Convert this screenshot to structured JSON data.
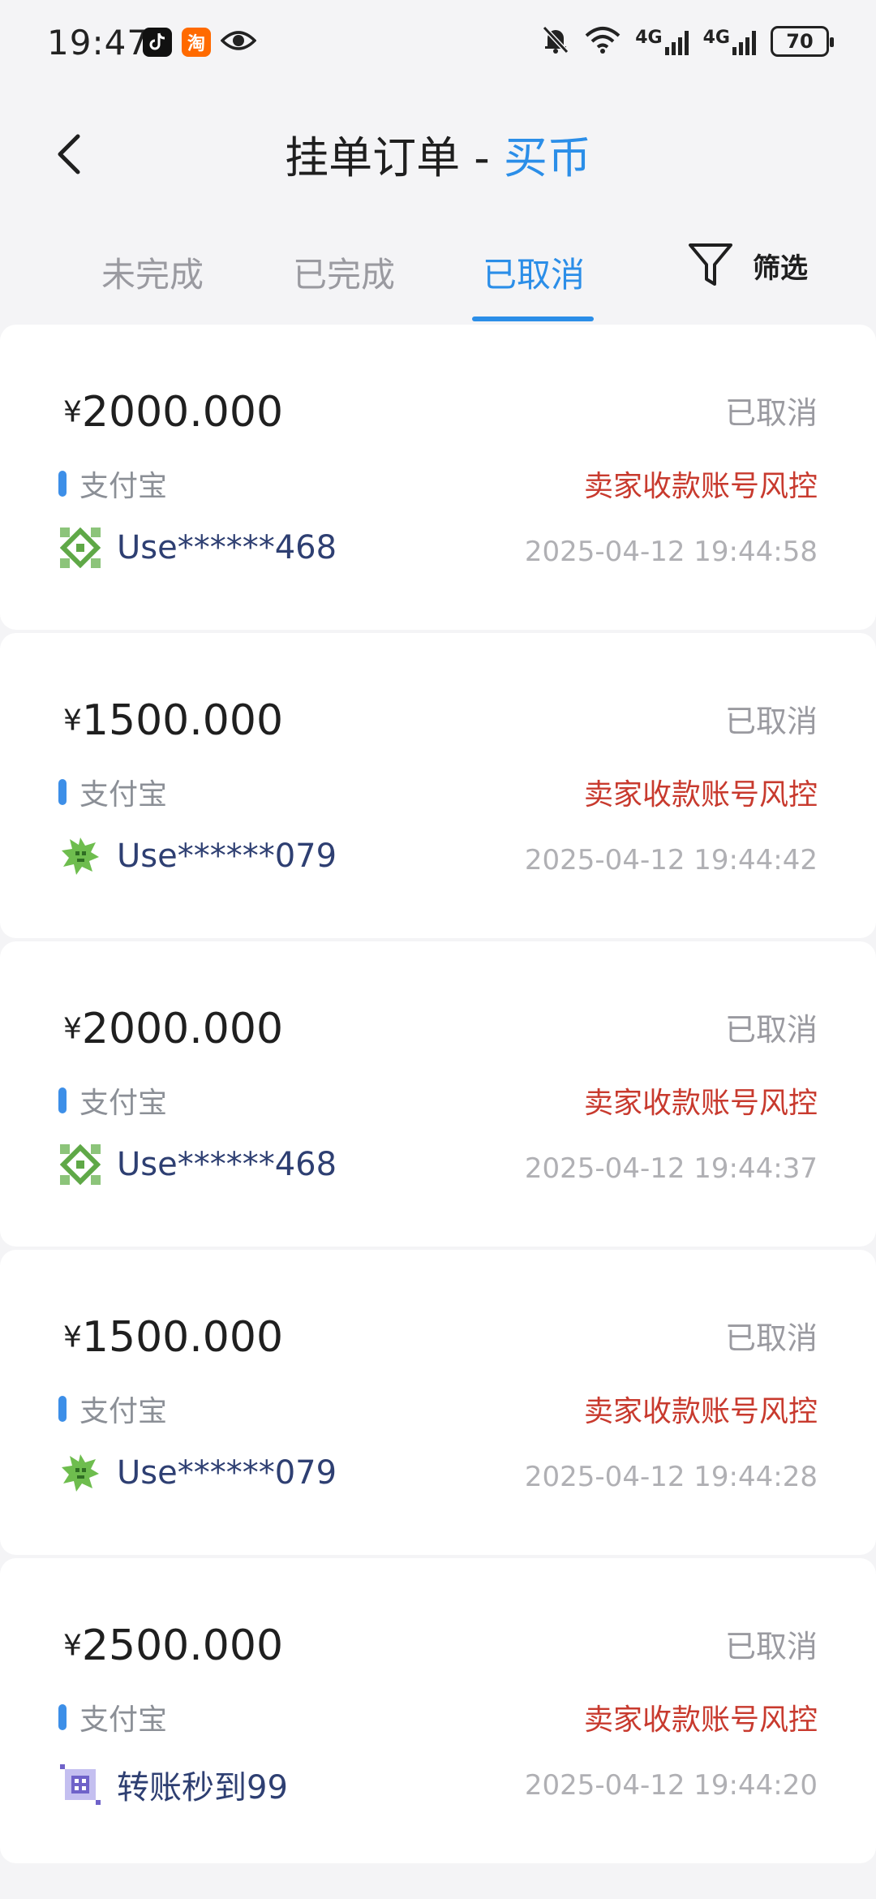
{
  "status_bar": {
    "time": "19:47",
    "app_icons": [
      "tiktok-icon",
      "taobao-icon",
      "eye-icon"
    ],
    "taobao_char": "淘",
    "network_label_1": "4G",
    "network_label_2": "4G",
    "battery": "70"
  },
  "header": {
    "title": "挂单订单",
    "separator": " - ",
    "subtitle": "买币",
    "accent_color": "#2b8ee8"
  },
  "tabs": [
    {
      "label": "未完成",
      "active": false
    },
    {
      "label": "已完成",
      "active": false
    },
    {
      "label": "已取消",
      "active": true
    }
  ],
  "filter": {
    "label": "筛选",
    "icon": "filter-icon"
  },
  "orders": [
    {
      "currency": "¥",
      "amount": "2000.000",
      "status": "已取消",
      "method": "支付宝",
      "reason": "卖家收款账号风控",
      "user": "Use******468",
      "time": "2025-04-12 19:44:58",
      "avatar": "green-diamond"
    },
    {
      "currency": "¥",
      "amount": "1500.000",
      "status": "已取消",
      "method": "支付宝",
      "reason": "卖家收款账号风控",
      "user": "Use******079",
      "time": "2025-04-12 19:44:42",
      "avatar": "green-gear"
    },
    {
      "currency": "¥",
      "amount": "2000.000",
      "status": "已取消",
      "method": "支付宝",
      "reason": "卖家收款账号风控",
      "user": "Use******468",
      "time": "2025-04-12 19:44:37",
      "avatar": "green-diamond"
    },
    {
      "currency": "¥",
      "amount": "1500.000",
      "status": "已取消",
      "method": "支付宝",
      "reason": "卖家收款账号风控",
      "user": "Use******079",
      "time": "2025-04-12 19:44:28",
      "avatar": "green-gear"
    },
    {
      "currency": "¥",
      "amount": "2500.000",
      "status": "已取消",
      "method": "支付宝",
      "reason": "卖家收款账号风控",
      "user": "转账秒到99",
      "time": "2025-04-12 19:44:20",
      "avatar": "purple-square"
    }
  ]
}
